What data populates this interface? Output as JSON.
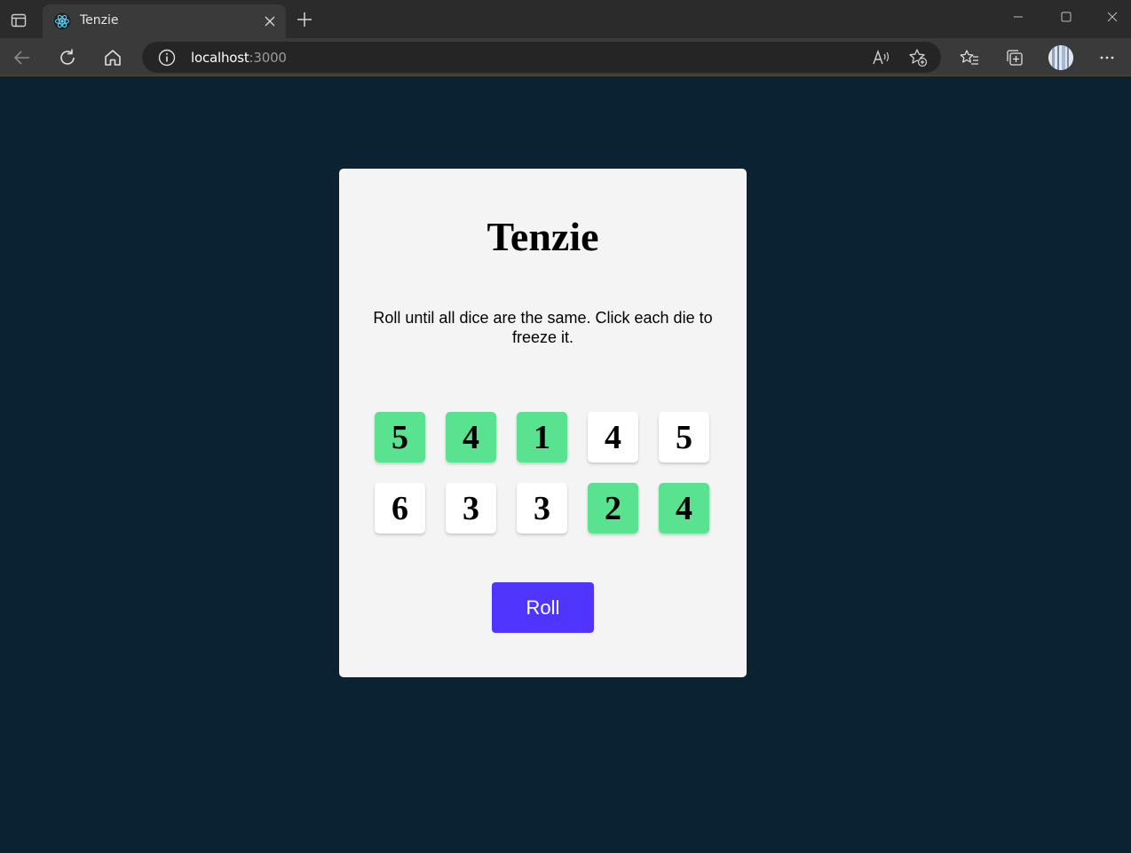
{
  "browser": {
    "tab_title": "Tenzie",
    "url_host": "localhost",
    "url_port": ":3000"
  },
  "app": {
    "title": "Tenzie",
    "instructions": "Roll until all dice are the same. Click each die to freeze it.",
    "roll_label": "Roll",
    "colors": {
      "background": "#0b2233",
      "card": "#f4f4f4",
      "held_die": "#59e391",
      "die": "#ffffff",
      "roll_button": "#5035ff"
    },
    "dice": [
      {
        "value": "5",
        "held": true
      },
      {
        "value": "4",
        "held": true
      },
      {
        "value": "1",
        "held": true
      },
      {
        "value": "4",
        "held": false
      },
      {
        "value": "5",
        "held": false
      },
      {
        "value": "6",
        "held": false
      },
      {
        "value": "3",
        "held": false
      },
      {
        "value": "3",
        "held": false
      },
      {
        "value": "2",
        "held": true
      },
      {
        "value": "4",
        "held": true
      }
    ]
  }
}
